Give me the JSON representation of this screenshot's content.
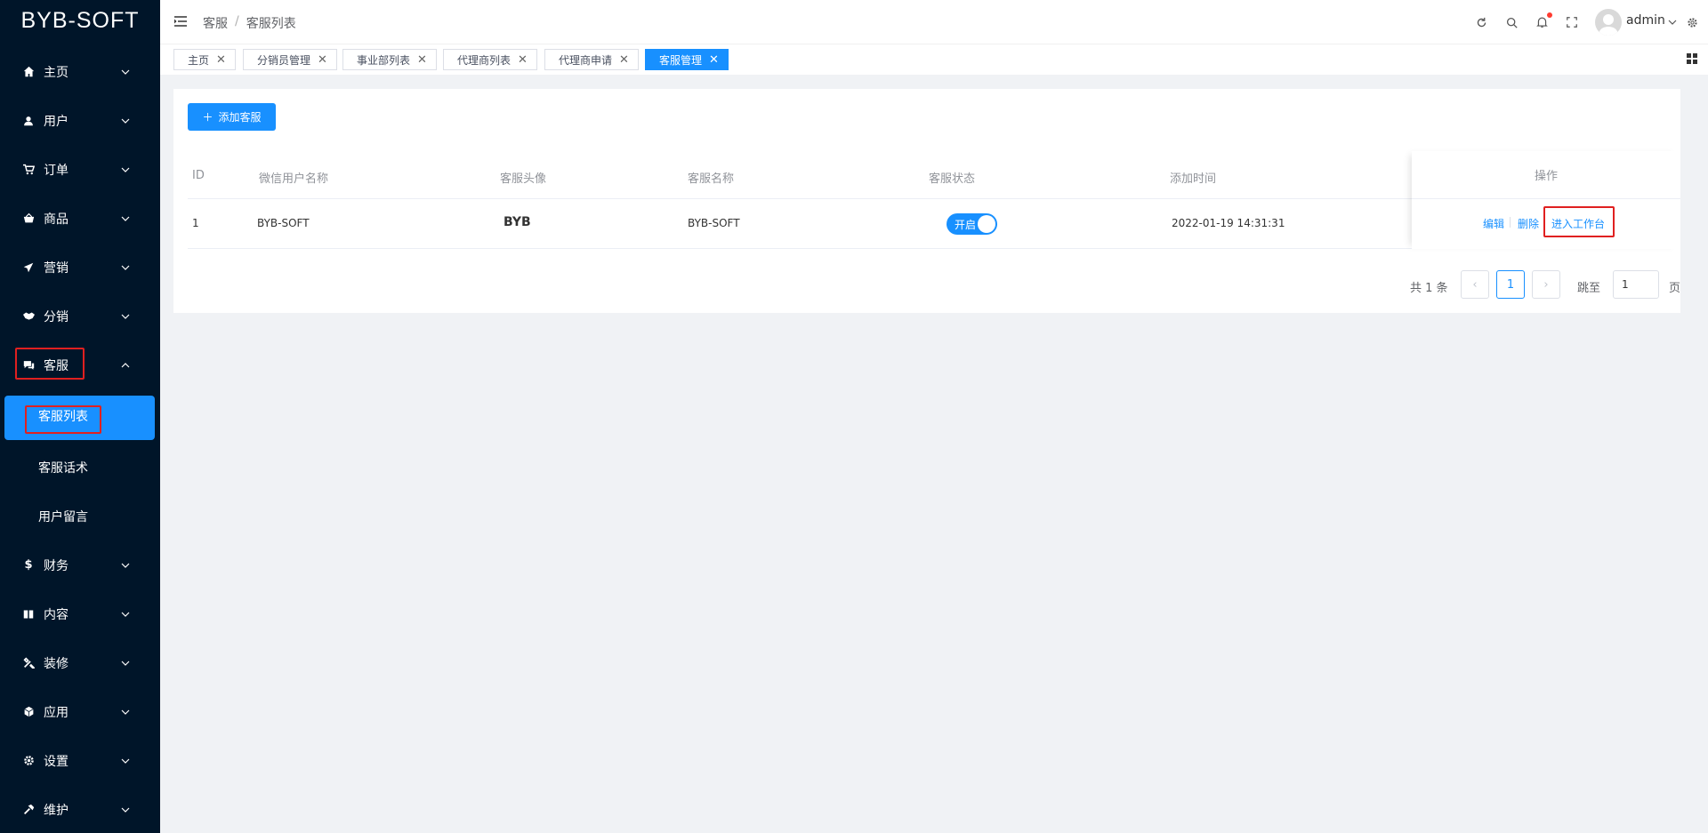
{
  "app": {
    "logo": "BYB-SOFT"
  },
  "sidebar": {
    "items": [
      {
        "label": "主页",
        "icon": "home-icon"
      },
      {
        "label": "用户",
        "icon": "user-icon"
      },
      {
        "label": "订单",
        "icon": "cart-icon"
      },
      {
        "label": "商品",
        "icon": "basket-icon"
      },
      {
        "label": "营销",
        "icon": "send-icon"
      },
      {
        "label": "分销",
        "icon": "handshake-icon"
      },
      {
        "label": "客服",
        "icon": "chat-icon",
        "expanded": true,
        "children": [
          {
            "label": "客服列表",
            "active": true
          },
          {
            "label": "客服话术"
          },
          {
            "label": "用户留言"
          }
        ]
      },
      {
        "label": "财务",
        "icon": "dollar-icon"
      },
      {
        "label": "内容",
        "icon": "book-icon"
      },
      {
        "label": "装修",
        "icon": "tools-icon"
      },
      {
        "label": "应用",
        "icon": "cube-icon"
      },
      {
        "label": "设置",
        "icon": "gear-icon"
      },
      {
        "label": "维护",
        "icon": "hammer-icon"
      }
    ]
  },
  "header": {
    "breadcrumb": [
      "客服",
      "客服列表"
    ],
    "user": "admin"
  },
  "tabs": [
    {
      "label": "主页",
      "active": false
    },
    {
      "label": "分销员管理",
      "active": false
    },
    {
      "label": "事业部列表",
      "active": false
    },
    {
      "label": "代理商列表",
      "active": false
    },
    {
      "label": "代理商申请",
      "active": false
    },
    {
      "label": "客服管理",
      "active": true
    }
  ],
  "main": {
    "add_button": "添加客服",
    "columns": [
      "ID",
      "微信用户名称",
      "客服头像",
      "客服名称",
      "客服状态",
      "添加时间",
      "操作"
    ],
    "rows": [
      {
        "id": "1",
        "wechat_name": "BYB-SOFT",
        "avatar_text": "BYB",
        "service_name": "BYB-SOFT",
        "status_label": "开启",
        "status_on": true,
        "added_time": "2022-01-19 14:31:31",
        "actions": [
          "编辑",
          "删除",
          "进入工作台"
        ]
      }
    ],
    "pagination": {
      "total_text": "共 1 条",
      "current_page": "1",
      "jump_label": "跳至",
      "jump_value": "1",
      "page_suffix": "页"
    }
  },
  "colors": {
    "primary": "#1890ff",
    "sidebar_bg": "#001529",
    "highlight_box": "#e02020"
  }
}
